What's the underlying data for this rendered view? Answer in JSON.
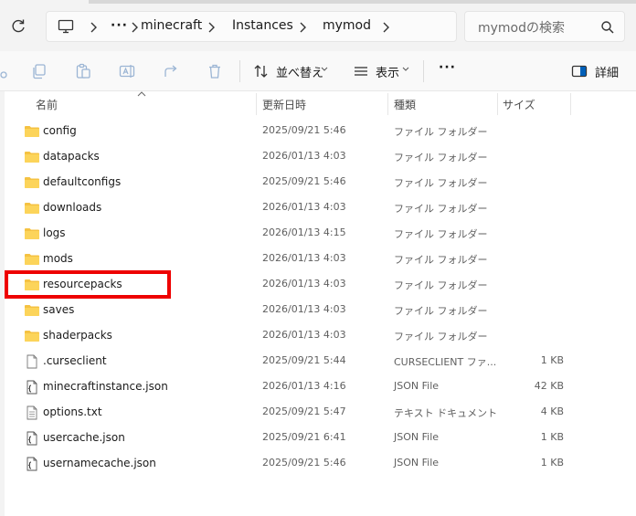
{
  "address": {
    "breadcrumbs": [
      "minecraft",
      "Instances",
      "mymod"
    ],
    "more": "···"
  },
  "search": {
    "placeholder": "mymodの検索"
  },
  "toolbar": {
    "sort_label": "並べ替え",
    "view_label": "表示",
    "more": "···",
    "details_label": "詳細"
  },
  "columns": {
    "name": "名前",
    "date": "更新日時",
    "type": "種類",
    "size": "サイズ"
  },
  "files": [
    {
      "name": "config",
      "date": "2025/09/21 5:46",
      "type": "ファイル フォルダー",
      "size": "",
      "icon": "folder-icon"
    },
    {
      "name": "datapacks",
      "date": "2026/01/13 4:03",
      "type": "ファイル フォルダー",
      "size": "",
      "icon": "folder-icon"
    },
    {
      "name": "defaultconfigs",
      "date": "2025/09/21 5:46",
      "type": "ファイル フォルダー",
      "size": "",
      "icon": "folder-icon"
    },
    {
      "name": "downloads",
      "date": "2026/01/13 4:03",
      "type": "ファイル フォルダー",
      "size": "",
      "icon": "folder-icon"
    },
    {
      "name": "logs",
      "date": "2026/01/13 4:15",
      "type": "ファイル フォルダー",
      "size": "",
      "icon": "folder-icon"
    },
    {
      "name": "mods",
      "date": "2026/01/13 4:03",
      "type": "ファイル フォルダー",
      "size": "",
      "icon": "folder-icon"
    },
    {
      "name": "resourcepacks",
      "date": "2026/01/13 4:03",
      "type": "ファイル フォルダー",
      "size": "",
      "icon": "folder-icon"
    },
    {
      "name": "saves",
      "date": "2026/01/13 4:03",
      "type": "ファイル フォルダー",
      "size": "",
      "icon": "folder-icon"
    },
    {
      "name": "shaderpacks",
      "date": "2026/01/13 4:03",
      "type": "ファイル フォルダー",
      "size": "",
      "icon": "folder-icon"
    },
    {
      "name": ".curseclient",
      "date": "2025/09/21 5:44",
      "type": "CURSECLIENT ファ...",
      "size": "1 KB",
      "icon": "file-icon"
    },
    {
      "name": "minecraftinstance.json",
      "date": "2026/01/13 4:16",
      "type": "JSON File",
      "size": "42 KB",
      "icon": "json-file-icon"
    },
    {
      "name": "options.txt",
      "date": "2025/09/21 5:47",
      "type": "テキスト ドキュメント",
      "size": "4 KB",
      "icon": "text-file-icon"
    },
    {
      "name": "usercache.json",
      "date": "2025/09/21 6:41",
      "type": "JSON File",
      "size": "1 KB",
      "icon": "json-file-icon"
    },
    {
      "name": "usernamecache.json",
      "date": "2025/09/21 5:46",
      "type": "JSON File",
      "size": "1 KB",
      "icon": "json-file-icon"
    }
  ],
  "colors": {
    "folder": "#f5c242",
    "highlight": "#ee0000",
    "accent": "#005fb8"
  }
}
